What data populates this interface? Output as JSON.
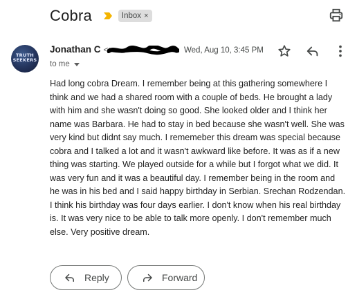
{
  "email": {
    "subject": "Cobra",
    "label": "Inbox",
    "label_remove": "×",
    "avatar_text": "TRUTH SEEKERS",
    "sender_name": "Jonathan C",
    "sender_email_prefix": "<",
    "date": "Wed, Aug 10, 3:45 PM",
    "recipient": "to me",
    "body": "Had long cobra Dream. I remember being at this gathering somewhere I think and we had a shared room with a couple of beds. He brought a lady with him and she wasn't doing so good. She looked older and I think her name was Barbara. He had to stay in bed because she wasn't well. She was very kind but didnt say much. I rememeber this dream was special because cobra and I talked a lot and it wasn't awkward like before. It was as if a new thing was starting. We played outside for a while but I forgot what we did. It was very fun and it was a beautiful day. I remember being in the room and he was in his bed and I said happy birthday in Serbian. Srechan Rodzendan. I think his birthday was four days earlier. I don't know when his real birthday is. It was very nice to be able to talk more openly. I don't remember much else. Very positive dream."
  },
  "actions": {
    "reply": "Reply",
    "forward": "Forward"
  },
  "icons": {
    "importance": "importance-marker-icon",
    "print": "print-icon",
    "star": "star-icon",
    "reply": "reply-icon",
    "more": "more-vert-icon",
    "forward": "forward-icon"
  },
  "colors": {
    "importance": "#f4b400",
    "label_bg": "#dddddd",
    "text": "#202124"
  }
}
